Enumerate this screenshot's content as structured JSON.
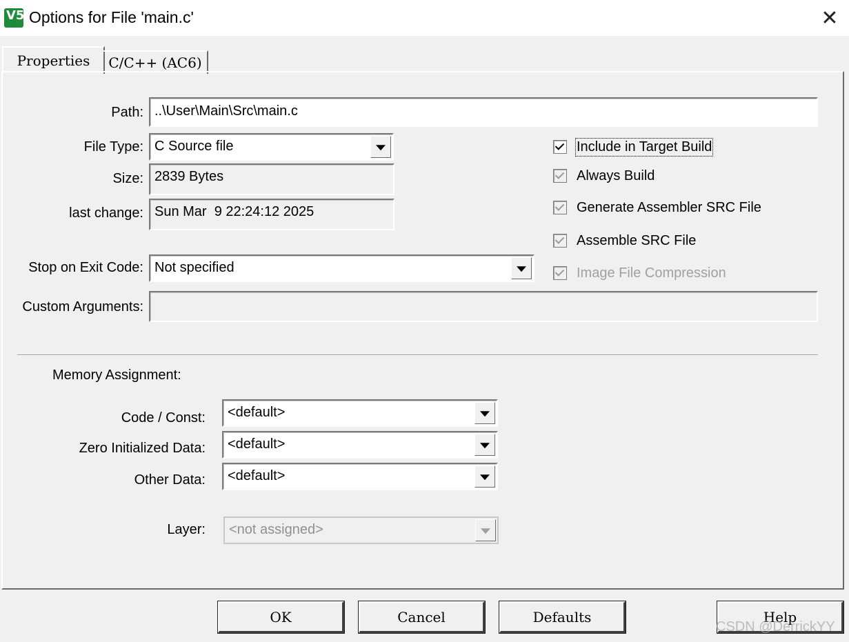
{
  "window": {
    "title": "Options for File 'main.c'",
    "icon_text": "V5",
    "close_glyph": "✕"
  },
  "tabs": [
    {
      "label": "Properties",
      "active": true
    },
    {
      "label": "C/C++ (AC6)",
      "active": false
    }
  ],
  "properties": {
    "path_label": "Path:",
    "path_value": "..\\User\\Main\\Src\\main.c",
    "file_type_label": "File Type:",
    "file_type_value": "C Source file",
    "size_label": "Size:",
    "size_value": "2839 Bytes",
    "last_change_label": "last change:",
    "last_change_value": "Sun Mar  9 22:24:12 2025",
    "stop_on_exit_label": "Stop on Exit Code:",
    "stop_on_exit_value": "Not specified",
    "custom_args_label": "Custom Arguments:",
    "custom_args_value": ""
  },
  "checkboxes": [
    {
      "label": "Include in Target Build",
      "checked": true,
      "enabled": true
    },
    {
      "label": "Always Build",
      "checked": true,
      "enabled": false
    },
    {
      "label": "Generate Assembler SRC File",
      "checked": true,
      "enabled": false
    },
    {
      "label": "Assemble SRC File",
      "checked": true,
      "enabled": false
    },
    {
      "label": "Image File Compression",
      "checked": true,
      "enabled": false
    }
  ],
  "memory": {
    "heading": "Memory Assignment:",
    "code_const_label": "Code / Const:",
    "code_const_value": "<default>",
    "zero_init_label": "Zero Initialized Data:",
    "zero_init_value": "<default>",
    "other_data_label": "Other Data:",
    "other_data_value": "<default>",
    "layer_label": "Layer:",
    "layer_value": "<not assigned>"
  },
  "buttons": {
    "ok": "OK",
    "cancel": "Cancel",
    "defaults": "Defaults",
    "help": "Help"
  },
  "watermark": "CSDN @DerrickYY"
}
